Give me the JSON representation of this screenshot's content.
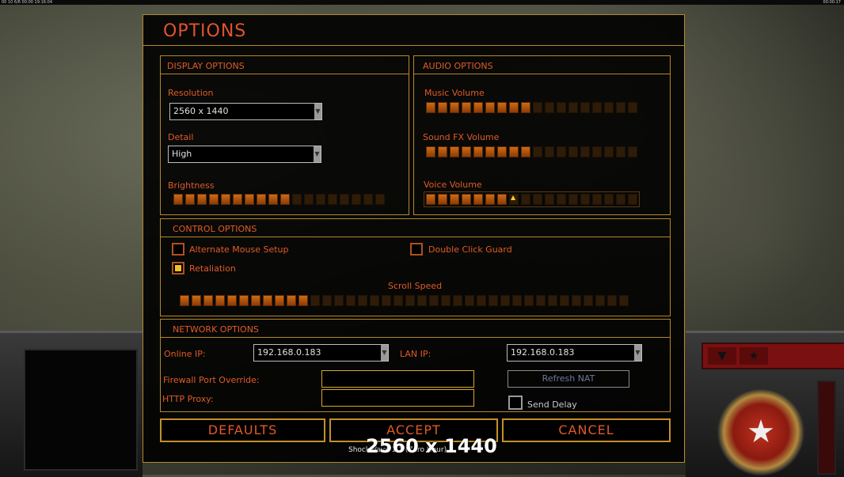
{
  "status_bar": {
    "left": "00 10 6/6 00:00 19:16:04",
    "right": "00:00:17"
  },
  "title": "OPTIONS",
  "display": {
    "title": "DISPLAY OPTIONS",
    "resolution_label": "Resolution",
    "resolution_value": "2560 x 1440",
    "detail_label": "Detail",
    "detail_value": "High",
    "brightness_label": "Brightness",
    "brightness_level": 0.55
  },
  "audio": {
    "title": "AUDIO OPTIONS",
    "music_label": "Music Volume",
    "music_level": 0.5,
    "sfx_label": "Sound FX Volume",
    "sfx_level": 0.5,
    "voice_label": "Voice Volume",
    "voice_level": 0.4
  },
  "control": {
    "title": "CONTROL OPTIONS",
    "alt_mouse_label": "Alternate Mouse Setup",
    "alt_mouse_checked": false,
    "double_click_label": "Double Click Guard",
    "double_click_checked": false,
    "retaliation_label": "Retaliation",
    "retaliation_checked": true,
    "scroll_label": "Scroll Speed",
    "scroll_level": 0.3
  },
  "network": {
    "title": "NETWORK OPTIONS",
    "online_ip_label": "Online IP:",
    "online_ip_value": "192.168.0.183",
    "lan_ip_label": "LAN IP:",
    "lan_ip_value": "192.168.0.183",
    "firewall_label": "Firewall Port Override:",
    "http_proxy_label": "HTTP Proxy:",
    "refresh_nat_label": "Refresh NAT",
    "send_delay_label": "Send Delay",
    "send_delay_checked": false
  },
  "buttons": {
    "defaults": "DEFAULTS",
    "accept": "ACCEPT",
    "cancel": "CANCEL"
  },
  "overlay": {
    "resolution_text": "2560 x 1440",
    "small_text": "ShockWave 1.1 (Zero Hour)"
  },
  "colors": {
    "accent": "#e05a28",
    "border": "#b5882a",
    "slider_on": "#d06a14",
    "slider_off": "#2e1c08"
  }
}
